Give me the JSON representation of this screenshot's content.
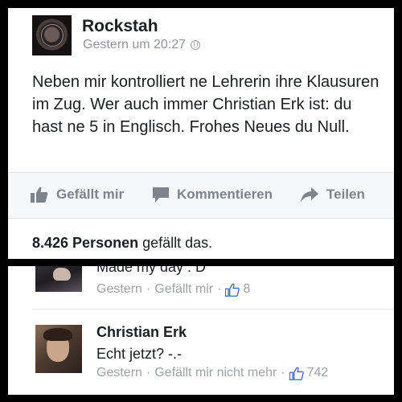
{
  "post": {
    "page_name": "Rockstah",
    "timestamp": "Gestern um 20:27",
    "privacy_icon": "globe-icon",
    "text": "Neben mir kontrolliert ne Lehrerin ihre Klausuren im Zug. Wer auch immer Christian Erk ist: du hast ne 5 in Englisch. Frohes Neues du Null.",
    "actions": {
      "like_label": "Gefällt mir",
      "comment_label": "Kommentieren",
      "share_label": "Teilen"
    },
    "likes_count": "8.426 Personen",
    "likes_suffix": " gefällt das."
  },
  "comments": [
    {
      "text": "Made my day : D",
      "time": "Gestern",
      "like_label": "Gefällt mir",
      "like_count": "8"
    },
    {
      "author": "Christian Erk",
      "text": "Echt jetzt? -.-",
      "time": "Gestern",
      "like_label": "Gefällt mir nicht mehr",
      "like_count": "742"
    }
  ],
  "separator": "·",
  "colors": {
    "meta_gray": "#90949c",
    "action_gray": "#7f838b",
    "like_blue": "#4267b2",
    "frame": "#000000"
  }
}
